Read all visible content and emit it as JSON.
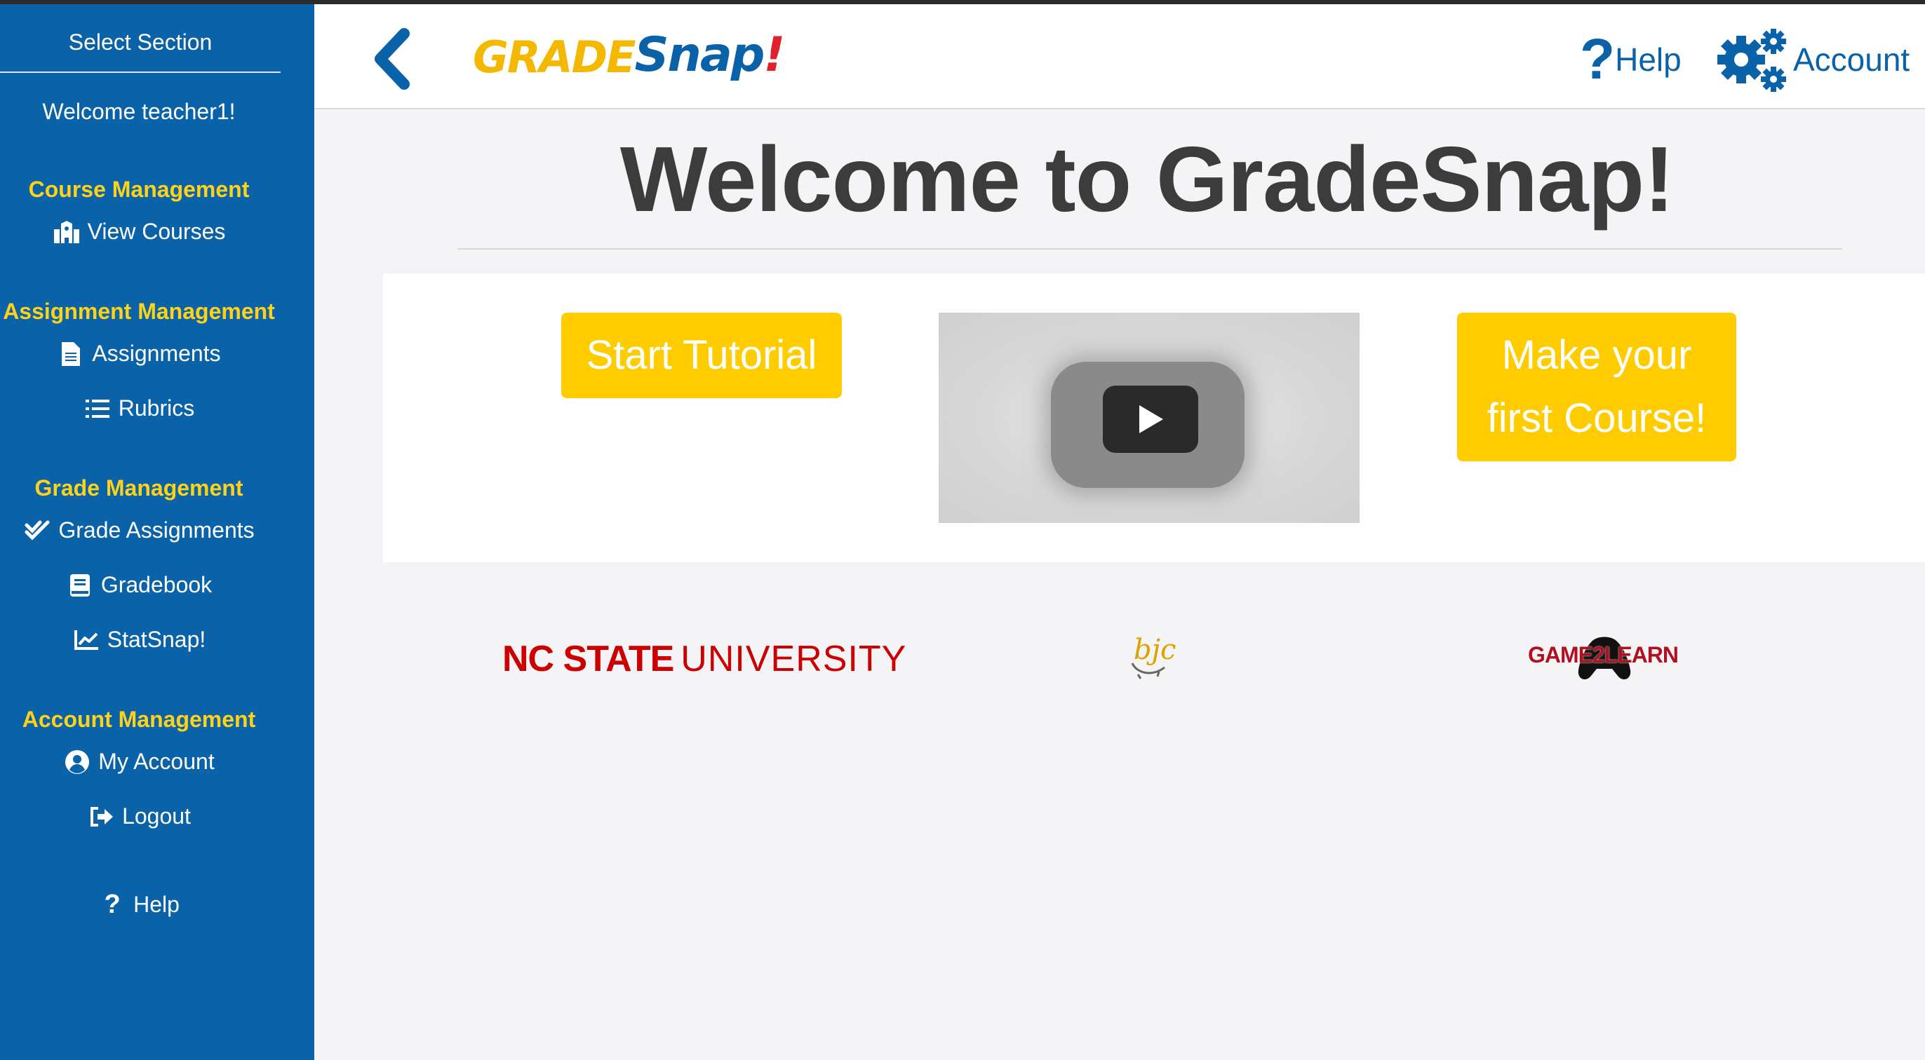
{
  "sidebar": {
    "title": "Select Section",
    "welcome": "Welcome teacher1!",
    "sections": [
      {
        "heading": "Course Management",
        "items": [
          {
            "label": "View Courses",
            "icon": "school-icon"
          }
        ]
      },
      {
        "heading": "Assignment Management",
        "items": [
          {
            "label": "Assignments",
            "icon": "document-icon"
          },
          {
            "label": "Rubrics",
            "icon": "list-icon"
          }
        ]
      },
      {
        "heading": "Grade Management",
        "items": [
          {
            "label": "Grade Assignments",
            "icon": "double-check-icon"
          },
          {
            "label": "Gradebook",
            "icon": "book-icon"
          },
          {
            "label": "StatSnap!",
            "icon": "line-chart-icon"
          }
        ]
      },
      {
        "heading": "Account Management",
        "items": [
          {
            "label": "My Account",
            "icon": "user-circle-icon"
          },
          {
            "label": "Logout",
            "icon": "sign-out-icon"
          }
        ]
      }
    ],
    "help_label": "Help"
  },
  "header": {
    "logo": {
      "part1": "GRADE",
      "part2": "Snap",
      "part3": "!"
    },
    "help_label": "Help",
    "account_label": "Account"
  },
  "main": {
    "title": "Welcome to GradeSnap!",
    "start_tutorial_label": "Start Tutorial",
    "first_course_line1": "Make your",
    "first_course_line2": "first Course!"
  },
  "partners": {
    "ncsu_bold": "NC STATE",
    "ncsu_regular": "UNIVERSITY",
    "bjc": "bjc",
    "game2learn": "GAME2LEARN"
  },
  "colors": {
    "sidebar_bg": "#0a62a8",
    "accent_yellow": "#ffcc00",
    "heading_yellow": "#ffd21a",
    "brand_blue": "#0a62a8",
    "ncsu_red": "#cc0000"
  }
}
